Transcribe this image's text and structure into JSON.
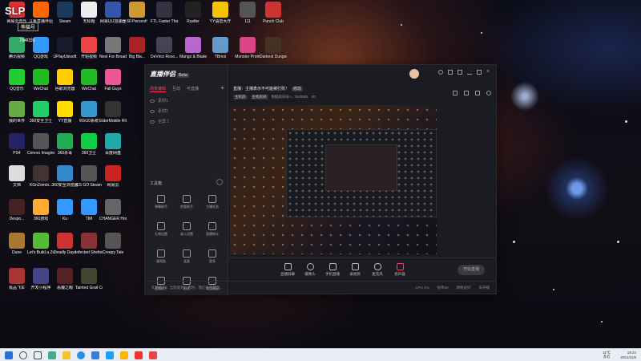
{
  "watermark": {
    "brand": "SLP",
    "tag": "熊猫号",
    "id": "764091"
  },
  "desktop": {
    "icons": [
      {
        "label": "网易云音乐",
        "color": "#d33"
      },
      {
        "label": "斗鱼直播伴侣",
        "color": "#f60"
      },
      {
        "label": "Steam",
        "color": "#1b3a5c"
      },
      {
        "label": "无标题",
        "color": "#eee"
      },
      {
        "label": "网易UU加速器",
        "color": "#35a"
      },
      {
        "label": "60 Percent!",
        "color": "#c93"
      },
      {
        "label": "FTL Faster Than Light",
        "color": "#334"
      },
      {
        "label": "Rustler",
        "color": "#222"
      },
      {
        "label": "YY语音大厅",
        "color": "#f5c400"
      },
      {
        "label": "111",
        "color": "#555"
      },
      {
        "label": "Punch Club",
        "color": "#c33"
      },
      {
        "label": "腾讯视频",
        "color": "#3a6"
      },
      {
        "label": "QQ游戏",
        "color": "#39f"
      },
      {
        "label": "UPlayUbisoft",
        "color": "#1a1a2e"
      },
      {
        "label": "开始视频",
        "color": "#e44"
      },
      {
        "label": "Nest For Broadcast",
        "color": "#777"
      },
      {
        "label": "Big Bla...",
        "color": "#a22"
      },
      {
        "label": "DeVinci Reso...",
        "color": "#445"
      },
      {
        "label": "Mango & Blade",
        "color": "#b6c"
      },
      {
        "label": "TBmoi",
        "color": "#69c"
      },
      {
        "label": "Monster Prom",
        "color": "#d48"
      },
      {
        "label": "Darkest Dungeon",
        "color": "#432"
      },
      {
        "label": "QQ音乐",
        "color": "#2c3"
      },
      {
        "label": "WeChat",
        "color": "#2b2"
      },
      {
        "label": "谷歌浏览器",
        "color": "#fc0"
      },
      {
        "label": "WeChat",
        "color": "#2b2"
      },
      {
        "label": "Fall Guys",
        "color": "#e59"
      },
      {
        "label": "我的世界",
        "color": "#6a4"
      },
      {
        "label": "360安全卫士",
        "color": "#2c6"
      },
      {
        "label": "YY直播",
        "color": "#fd0"
      },
      {
        "label": "Win10系统",
        "color": "#39c"
      },
      {
        "label": "ElderMobile RIGentra4",
        "color": "#333"
      },
      {
        "label": "PS4",
        "color": "#226"
      },
      {
        "label": "Cerevo Imagine",
        "color": "#555"
      },
      {
        "label": "360杀毒",
        "color": "#2a5"
      },
      {
        "label": "360卫士",
        "color": "#1c4"
      },
      {
        "label": "百度网盘",
        "color": "#2aa"
      },
      {
        "label": "文档",
        "color": "#ddd"
      },
      {
        "label": "KGnZombi...",
        "color": "#433"
      },
      {
        "label": "360安全浏览器",
        "color": "#38c"
      },
      {
        "label": "CS GO Steam",
        "color": "#555"
      },
      {
        "label": "网易云",
        "color": "#c22"
      },
      {
        "label": "Despo...",
        "color": "#422"
      },
      {
        "label": "360游戏",
        "color": "#fa3"
      },
      {
        "label": "Ku",
        "color": "#39f"
      },
      {
        "label": "TIM",
        "color": "#39f"
      },
      {
        "label": "CHANGER Homebo...",
        "color": "#666"
      },
      {
        "label": "Dune",
        "color": "#a73"
      },
      {
        "label": "Let's Build a Zoo",
        "color": "#5b3"
      },
      {
        "label": "Deadly Days",
        "color": "#c33"
      },
      {
        "label": "Infected Shelter",
        "color": "#833"
      },
      {
        "label": "Creepy Tale",
        "color": "#555"
      },
      {
        "label": "极品飞车",
        "color": "#a33"
      },
      {
        "label": "开发小程序",
        "color": "#448"
      },
      {
        "label": "恶魔之眼",
        "color": "#522"
      },
      {
        "label": "Tainted Grail Conq...",
        "color": "#443"
      }
    ]
  },
  "app": {
    "name": "直播伴侣",
    "version_badge": "Beta",
    "tabs": [
      "场景编辑",
      "互动",
      "可直播"
    ],
    "layers": [
      "素材1",
      "素材2",
      "全屏 1"
    ],
    "toolbox_title": "工具箱",
    "tools": [
      "弹幕助手",
      "房管助手",
      "主播任务",
      "礼物设置",
      "录入设置",
      "直播统计",
      "福利贴",
      "连麦",
      "更多",
      "直播助手",
      "粉丝",
      "商品橱窗"
    ],
    "topic": "直播：主播表示不可能被打败！",
    "topic_edit": "修改",
    "meta_chips": [
      "主机房",
      "主机房间"
    ],
    "meta_text": "根据房间号 L. 7640891",
    "meta_views": "20",
    "controls": [
      "直播屏幕",
      "摄像头",
      "手机直播",
      "录视频",
      "麦克风",
      "扬声器"
    ],
    "start_button": "开始直播",
    "status_left": "礼物提示：当您收到礼物时，我们会提醒您。",
    "status_right": [
      "CPU 1%",
      "帧率60",
      "网络良好",
      "未开播"
    ]
  },
  "taskbar": {
    "weather": "11℃",
    "weather_desc": "多云",
    "time": "19:24",
    "date": "2021/11/6"
  },
  "colors": {
    "accent": "#ff3d5a",
    "window_bg": "#1b1c21",
    "taskbar": "#e9eef5"
  }
}
